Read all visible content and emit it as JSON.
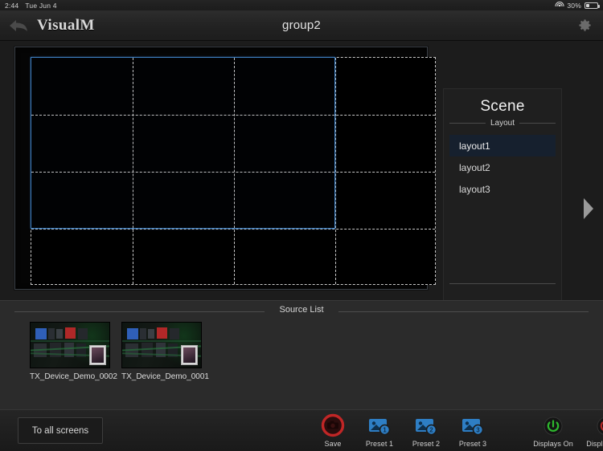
{
  "statusbar": {
    "time": "2:44",
    "date": "Tue Jun 4",
    "battery_percent": "30%",
    "wifi_icon": "wifi-icon",
    "battery_icon": "battery-icon"
  },
  "header": {
    "back_icon": "back-arrow-icon",
    "app_title": "VisualM",
    "group_title": "group2",
    "settings_icon": "gear-icon"
  },
  "canvas": {
    "columns": 4,
    "rows": 4,
    "selection": {
      "col_start": 1,
      "col_end": 3,
      "row_start": 1,
      "row_end": 3
    },
    "selection_color": "#3e7fc1",
    "grid_line_color": "#c9c9c9"
  },
  "scene": {
    "title": "Scene",
    "legend": "Layout",
    "layouts": [
      {
        "label": "layout1",
        "selected": true
      },
      {
        "label": "layout2",
        "selected": false
      },
      {
        "label": "layout3",
        "selected": false
      }
    ],
    "selected_bg": "#16202e",
    "next_icon": "next-arrow-icon"
  },
  "source_list": {
    "title": "Source List",
    "items": [
      {
        "label": "TX_Device_Demo_0002"
      },
      {
        "label": "TX_Device_Demo_0001"
      }
    ]
  },
  "bottombar": {
    "all_screens_label": "To all screens",
    "tools": [
      {
        "label": "Save",
        "icon": "save-camera-icon",
        "color": "#c02626"
      },
      {
        "label": "Preset 1",
        "icon": "preset-image-icon",
        "color": "#2e7ec4",
        "badge": "1"
      },
      {
        "label": "Preset 2",
        "icon": "preset-image-icon",
        "color": "#2e7ec4",
        "badge": "2"
      },
      {
        "label": "Preset 3",
        "icon": "preset-image-icon",
        "color": "#2e7ec4",
        "badge": "3"
      },
      {
        "label": "Displays On",
        "icon": "power-on-icon",
        "color": "#2eb82e"
      },
      {
        "label": "Displays Off",
        "icon": "power-off-icon",
        "color": "#c02626"
      }
    ]
  }
}
